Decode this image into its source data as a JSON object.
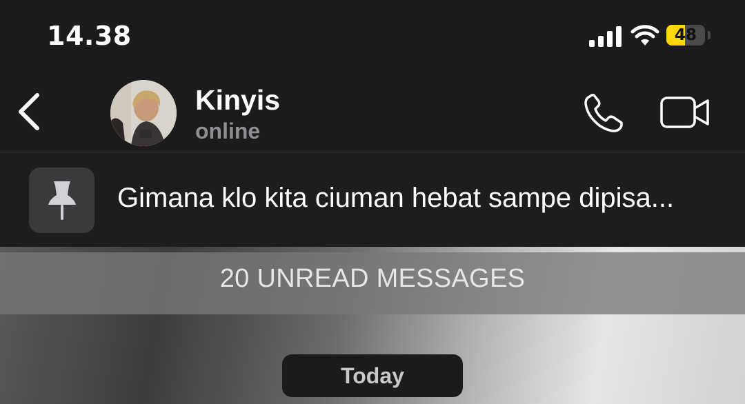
{
  "status_bar": {
    "time": "14.38",
    "battery_level": "48",
    "battery_color": "#ffd60a",
    "icons": [
      "signal-icon",
      "wifi-icon",
      "battery-icon"
    ]
  },
  "header": {
    "back_icon": "chevron-left-icon",
    "contact_name": "Kinyis",
    "contact_status": "online",
    "call_icon": "phone-icon",
    "video_icon": "video-camera-icon"
  },
  "pinned": {
    "icon": "pin-icon",
    "message": "Gimana klo kita ciuman hebat sampe dipisa..."
  },
  "chat": {
    "unread_label": "20 UNREAD MESSAGES",
    "date_label": "Today"
  }
}
